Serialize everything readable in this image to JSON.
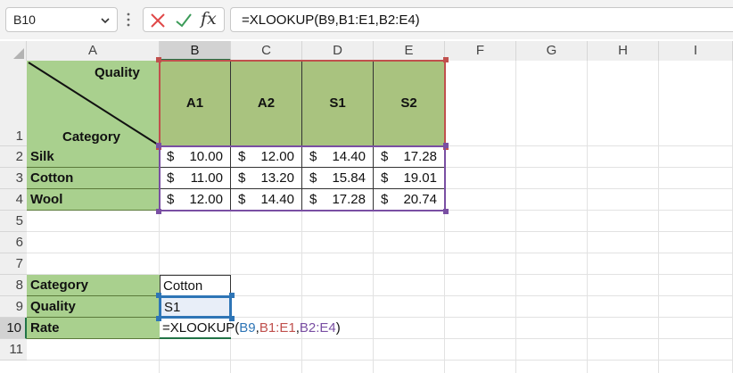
{
  "namebox": {
    "value": "B10"
  },
  "formula_bar": {
    "fx_label": "fx",
    "formula": "=XLOOKUP(B9,B1:E1,B2:E4)"
  },
  "columns": [
    "A",
    "B",
    "C",
    "D",
    "E",
    "F",
    "G",
    "H",
    "I"
  ],
  "rows": [
    "1",
    "2",
    "3",
    "4",
    "5",
    "6",
    "7",
    "8",
    "9",
    "10",
    "11"
  ],
  "table": {
    "header_top": "Quality",
    "header_bottom": "Category",
    "qualities": [
      "A1",
      "A2",
      "S1",
      "S2"
    ],
    "currency": "$",
    "data": [
      {
        "category": "Silk",
        "values": [
          "10.00",
          "12.00",
          "14.40",
          "17.28"
        ]
      },
      {
        "category": "Cotton",
        "values": [
          "11.00",
          "13.20",
          "15.84",
          "19.01"
        ]
      },
      {
        "category": "Wool",
        "values": [
          "12.00",
          "14.40",
          "17.28",
          "20.74"
        ]
      }
    ]
  },
  "lookup": {
    "category_label": "Category",
    "category_value": "Cotton",
    "quality_label": "Quality",
    "quality_value": "S1",
    "rate_label": "Rate",
    "rate_formula_prefix": "=XLOOKUP(",
    "ref1": "B9",
    "sep1": ",",
    "ref2": "B1:E1",
    "sep2": ",",
    "ref3": "B2:E4",
    "suffix": ")"
  },
  "colors": {
    "ref1": "#2e75b6",
    "ref2": "#c0504d",
    "ref3": "#7a4fa3",
    "cancel": "#e04848",
    "enter": "#3b9b58",
    "select": "#217346"
  }
}
